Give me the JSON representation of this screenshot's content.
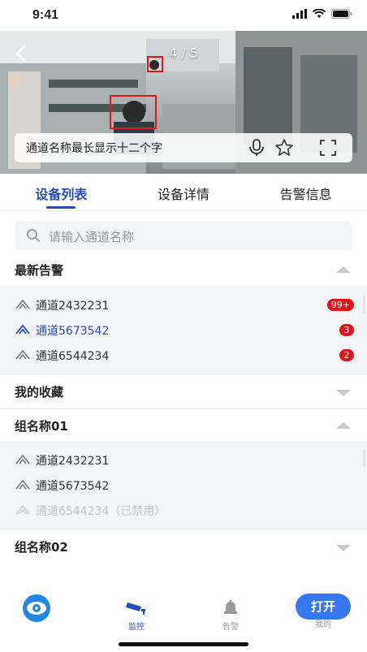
{
  "status": {
    "time": "9:41"
  },
  "video": {
    "counter": "4 / 5",
    "channel_title": "通道名称最长显示十二个字"
  },
  "tabs": [
    {
      "label": "设备列表",
      "active": true
    },
    {
      "label": "设备详情",
      "active": false
    },
    {
      "label": "告警信息",
      "active": false
    }
  ],
  "search": {
    "placeholder": "请输入通道名称"
  },
  "sections": {
    "latest_alarm": {
      "title": "最新告警",
      "items": [
        {
          "label": "通道2432231",
          "badge": "99+"
        },
        {
          "label": "通道5673542",
          "badge": "3"
        },
        {
          "label": "通道6544234",
          "badge": "2"
        }
      ]
    },
    "favorites": {
      "title": "我的收藏"
    },
    "group1": {
      "title": "组名称01",
      "items": [
        {
          "label": "通道2432231"
        },
        {
          "label": "通道5673542"
        },
        {
          "label": "通道6544234（已禁用）"
        }
      ]
    },
    "group2": {
      "title": "组名称02"
    }
  },
  "bottom_nav": {
    "items": [
      {
        "label": ""
      },
      {
        "label": "监控"
      },
      {
        "label": "告警"
      },
      {
        "label": "我的"
      }
    ],
    "open_button": "打开"
  },
  "colors": {
    "accent": "#2b4bb6",
    "badge": "#e1121c",
    "button": "#3877f2"
  }
}
